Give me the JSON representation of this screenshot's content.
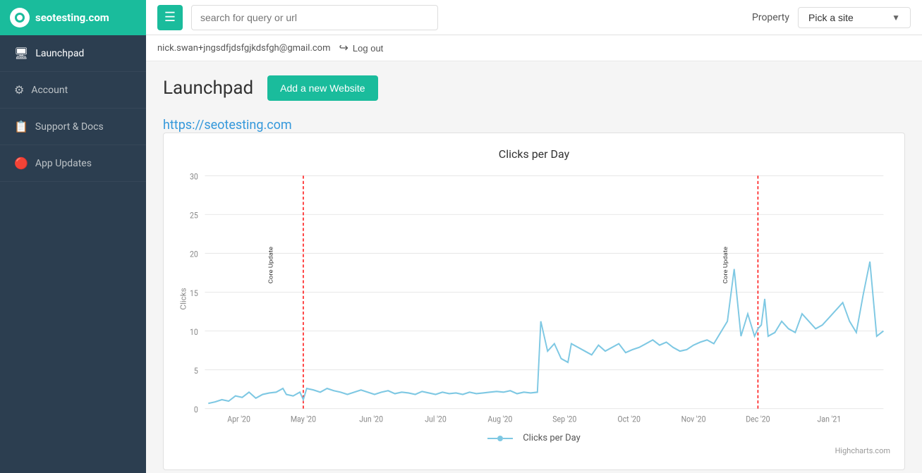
{
  "sidebar": {
    "logo_text": "seotesting.com",
    "items": [
      {
        "id": "launchpad",
        "label": "Launchpad",
        "icon": "🖥",
        "active": true
      },
      {
        "id": "account",
        "label": "Account",
        "icon": "⚙",
        "active": false
      },
      {
        "id": "support-docs",
        "label": "Support & Docs",
        "icon": "📋",
        "active": false
      },
      {
        "id": "app-updates",
        "label": "App Updates",
        "icon": "🔴",
        "active": false
      }
    ]
  },
  "topnav": {
    "search_placeholder": "search for query or url",
    "property_label": "Property",
    "pick_site_label": "Pick a site"
  },
  "userbar": {
    "email": "nick.swan+jngsdfjdsfgjkdsfgh@gmail.com",
    "logout_label": "Log out"
  },
  "content": {
    "page_title": "Launchpad",
    "add_website_btn": "Add a new Website",
    "site_url": "https://seotesting.com",
    "chart_title": "Clicks per Day",
    "chart_legend": "Clicks per Day",
    "highcharts_credit": "Highcharts.com",
    "y_axis_label": "Clicks",
    "x_labels": [
      "Apr '20",
      "May '20",
      "Jun '20",
      "Jul '20",
      "Aug '20",
      "Sep '20",
      "Oct '20",
      "Nov '20",
      "Dec '20",
      "Jan '21"
    ],
    "y_labels": [
      "0",
      "5",
      "10",
      "15",
      "20",
      "25",
      "30"
    ],
    "annotations": [
      {
        "label": "Core Update",
        "x_index": 1
      },
      {
        "label": "Core Update",
        "x_index": 8
      }
    ]
  }
}
